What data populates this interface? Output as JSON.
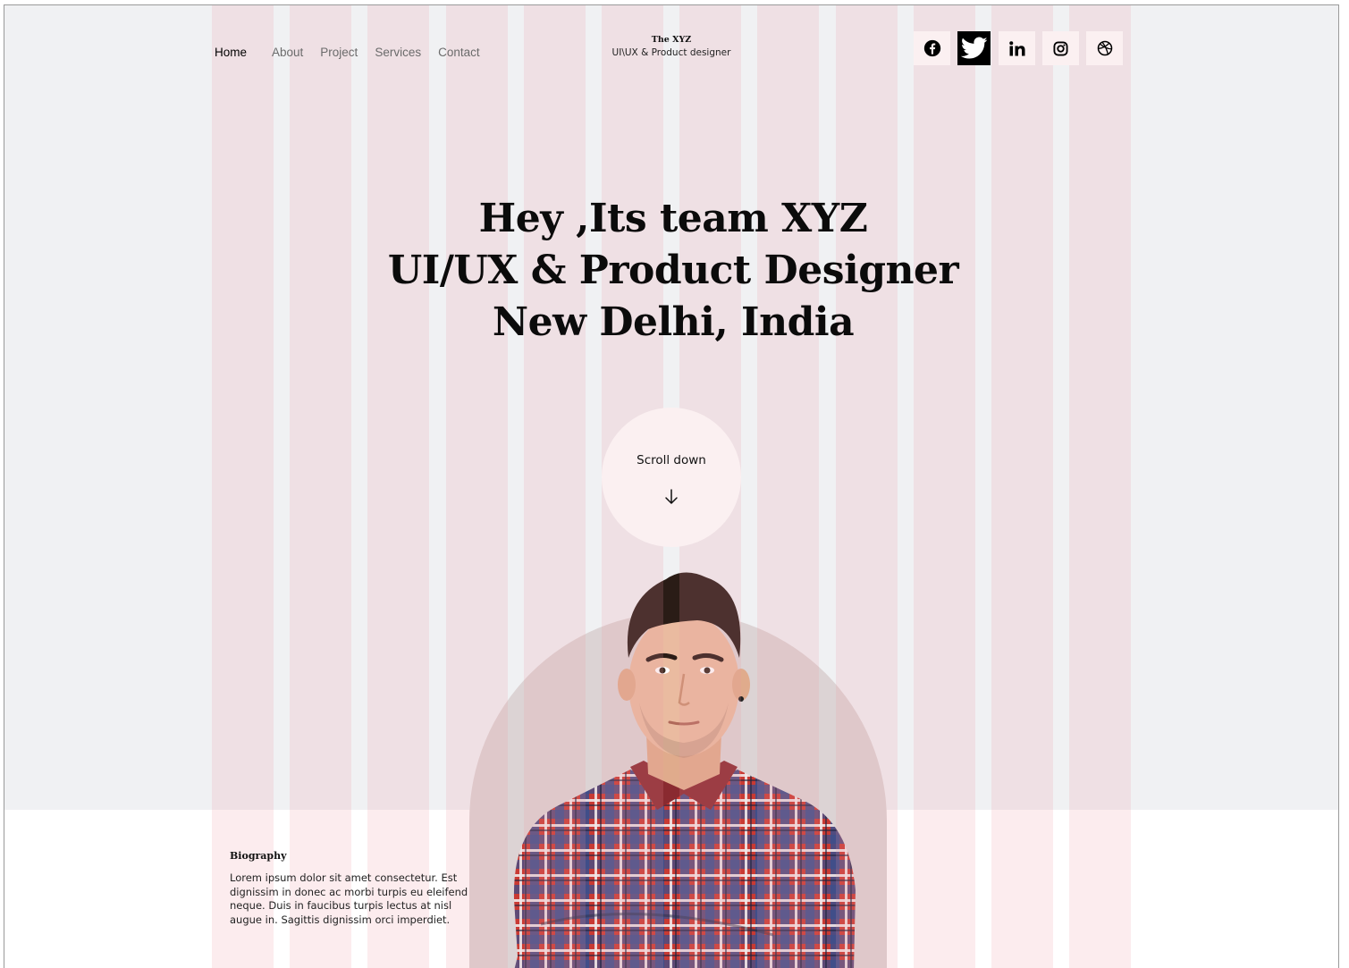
{
  "nav": {
    "items": [
      {
        "label": "Home",
        "active": true
      },
      {
        "label": "About",
        "active": false
      },
      {
        "label": "Project",
        "active": false
      },
      {
        "label": "Services",
        "active": false
      },
      {
        "label": "Contact",
        "active": false
      }
    ]
  },
  "brand": {
    "title": "The XYZ",
    "subtitle": "UI\\UX & Product designer"
  },
  "socials": [
    {
      "icon": "facebook-icon"
    },
    {
      "icon": "twitter-icon",
      "highlighted": true
    },
    {
      "icon": "linkedin-icon"
    },
    {
      "icon": "instagram-icon"
    },
    {
      "icon": "dribbble-icon"
    }
  ],
  "hero": {
    "line1": "Hey ,Its team  XYZ",
    "line2": "UI/UX & Product Designer",
    "line3": "New Delhi, India"
  },
  "scroll": {
    "label": "Scroll down",
    "icon": "arrow-down-icon"
  },
  "bio": {
    "title": "Biography",
    "text": "Lorem ipsum dolor sit amet consectetur. Est dignissim in donec ac morbi turpis eu eleifend neque. Duis in faucibus turpis lectus at nisl augue in. Sagittis dignissim orci imperdiet."
  },
  "colors": {
    "background": "#f0f1f3",
    "grid_overlay": "#f096a0",
    "arch": "#dcd3d4",
    "accent_soft": "#fbf0f1",
    "text": "#0b0b0b"
  }
}
